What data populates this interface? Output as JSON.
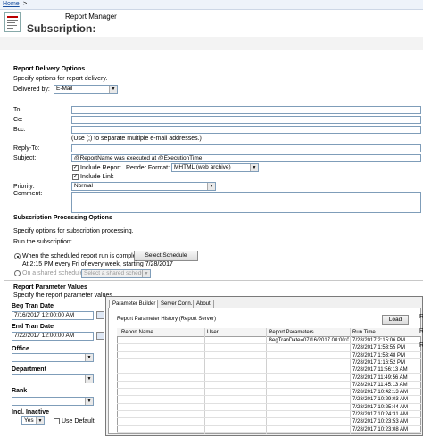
{
  "breadcrumb": {
    "home": "Home",
    "sep": ">"
  },
  "header": {
    "app_name": "Report Manager",
    "title": "Subscription:"
  },
  "delivery": {
    "heading": "Report Delivery Options",
    "desc": "Specify options for report delivery.",
    "delivered_by_label": "Delivered by:",
    "delivered_by_value": "E-Mail",
    "to_label": "To:",
    "cc_label": "Cc:",
    "bcc_label": "Bcc:",
    "separator_hint": "(Use (;) to separate multiple e-mail addresses.)",
    "reply_to_label": "Reply-To:",
    "subject_label": "Subject:",
    "subject_value": "@ReportName was executed at @ExecutionTime",
    "include_report_label": "Include Report",
    "render_format_label": "Render Format:",
    "render_format_value": "MHTML (web archive)",
    "include_link_label": "Include Link",
    "priority_label": "Priority:",
    "priority_value": "Normal",
    "comment_label": "Comment:"
  },
  "processing": {
    "heading": "Subscription Processing Options",
    "desc": "Specify options for subscription processing.",
    "run_label": "Run the subscription:",
    "option1": "When the scheduled report run is complete.",
    "select_schedule": "Select Schedule",
    "schedule_desc": "At 2:15 PM every Fri of every week, starting 7/28/2017",
    "option2": "On a shared schedule:",
    "shared_placeholder": "Select a shared schedule"
  },
  "params": {
    "heading": "Report Parameter Values",
    "desc": "Specify the report parameter values",
    "beg_label": "Beg Tran Date",
    "beg_value": "7/16/2017 12:00:00 AM",
    "end_label": "End Tran Date",
    "end_value": "7/22/2017 12:00:00 AM",
    "office_label": "Office",
    "department_label": "Department",
    "rank_label": "Rank",
    "incl_inactive_label": "Incl. Inactive",
    "incl_inactive_value": "Yes",
    "use_default_label": "Use Default"
  },
  "popup": {
    "tabs": [
      "Parameter Builder",
      "Server Conn.",
      "About"
    ],
    "history_label": "Report Parameter History (Report Server)",
    "load_button": "Load",
    "columns": [
      "Report Name",
      "User",
      "Report Parameters",
      "Run Time"
    ],
    "rows": [
      {
        "params": "BegTranDate=07/16/2017 00:00:00",
        "time": "7/28/2017 2:15:06 PM"
      },
      {
        "params": "",
        "time": "7/28/2017 1:53:55 PM"
      },
      {
        "params": "",
        "time": "7/28/2017 1:53:48 PM"
      },
      {
        "params": "",
        "time": "7/28/2017 1:16:52 PM"
      },
      {
        "params": "",
        "time": "7/28/2017 11:56:13 AM"
      },
      {
        "params": "",
        "time": "7/28/2017 11:49:56 AM"
      },
      {
        "params": "",
        "time": "7/28/2017 11:45:13 AM"
      },
      {
        "params": "",
        "time": "7/28/2017 10:42:13 AM"
      },
      {
        "params": "",
        "time": "7/28/2017 10:29:03 AM"
      },
      {
        "params": "",
        "time": "7/28/2017 10:25:44 AM"
      },
      {
        "params": "",
        "time": "7/28/2017 10:24:31 AM"
      },
      {
        "params": "",
        "time": "7/28/2017 10:23:53 AM"
      },
      {
        "params": "",
        "time": "7/28/2017 10:23:08 AM"
      }
    ],
    "side_letters": [
      "R",
      "R",
      "R"
    ]
  }
}
